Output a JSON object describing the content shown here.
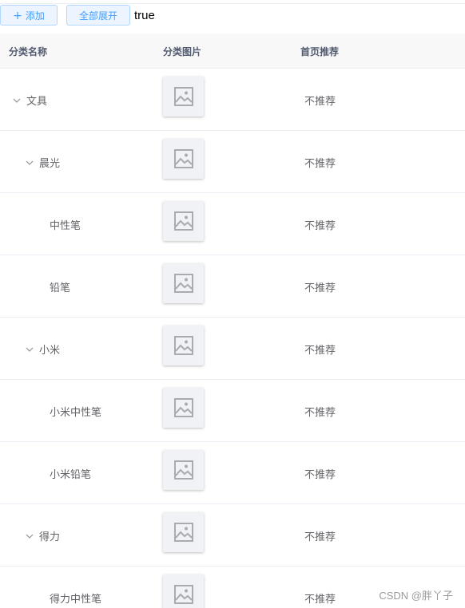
{
  "toolbar": {
    "add_icon": "plus-icon",
    "add_label": "添加",
    "expand_label": "全部展开",
    "state_text": "true"
  },
  "table": {
    "headers": [
      "分类名称",
      "分类图片",
      "首页推荐"
    ],
    "rows": [
      {
        "name": "文具",
        "level": 0,
        "expandable": true,
        "image_icon": "image-placeholder-icon",
        "recommend": "不推荐"
      },
      {
        "name": "晨光",
        "level": 1,
        "expandable": true,
        "image_icon": "image-placeholder-icon",
        "recommend": "不推荐"
      },
      {
        "name": "中性笔",
        "level": 2,
        "expandable": false,
        "image_icon": "image-placeholder-icon",
        "recommend": "不推荐"
      },
      {
        "name": "铅笔",
        "level": 2,
        "expandable": false,
        "image_icon": "image-placeholder-icon",
        "recommend": "不推荐"
      },
      {
        "name": "小米",
        "level": 1,
        "expandable": true,
        "image_icon": "image-placeholder-icon",
        "recommend": "不推荐"
      },
      {
        "name": "小米中性笔",
        "level": 2,
        "expandable": false,
        "image_icon": "image-placeholder-icon",
        "recommend": "不推荐"
      },
      {
        "name": "小米铅笔",
        "level": 2,
        "expandable": false,
        "image_icon": "image-placeholder-icon",
        "recommend": "不推荐"
      },
      {
        "name": "得力",
        "level": 1,
        "expandable": true,
        "image_icon": "image-placeholder-icon",
        "recommend": "不推荐"
      },
      {
        "name": "得力中性笔",
        "level": 2,
        "expandable": false,
        "image_icon": "image-placeholder-icon",
        "recommend": "不推荐"
      }
    ]
  },
  "watermark": "CSDN @胖丫子"
}
